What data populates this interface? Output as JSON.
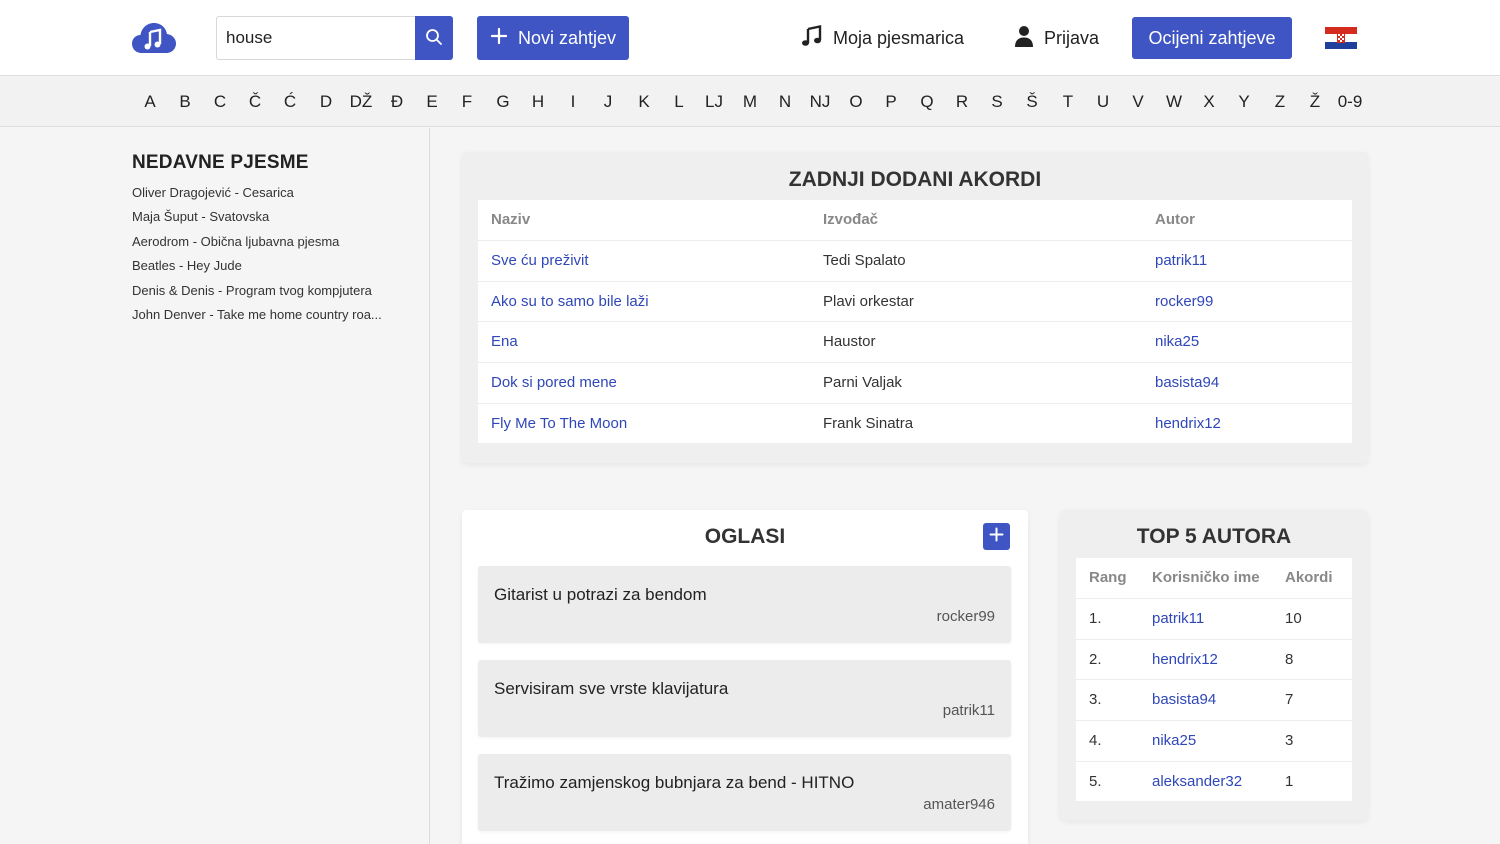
{
  "header": {
    "logo": "music-cloud-logo",
    "search_value": "house",
    "search_placeholder": "",
    "new_request_label": "Novi zahtjev",
    "songbook_label": "Moja pjesmarica",
    "login_label": "Prijava",
    "rate_requests_label": "Ocijeni zahtjeve",
    "language_flag": "croatian-flag"
  },
  "alphabet": [
    "A",
    "B",
    "C",
    "Č",
    "Ć",
    "D",
    "DŽ",
    "Đ",
    "E",
    "F",
    "G",
    "H",
    "I",
    "J",
    "K",
    "L",
    "LJ",
    "M",
    "N",
    "NJ",
    "O",
    "P",
    "Q",
    "R",
    "S",
    "Š",
    "T",
    "U",
    "V",
    "W",
    "X",
    "Y",
    "Z",
    "Ž",
    "0-9"
  ],
  "recent": {
    "title": "NEDAVNE PJESME",
    "items": [
      "Oliver Dragojević - Cesarica",
      "Maja Šuput - Svatovska",
      "Aerodrom - Obična ljubavna pjesma",
      "Beatles - Hey Jude",
      "Denis & Denis - Program tvog kompjutera",
      "John Denver - Take me home country roa..."
    ]
  },
  "latest_chords": {
    "title": "ZADNJI DODANI AKORDI",
    "columns": [
      "Naziv",
      "Izvođač",
      "Autor"
    ],
    "rows": [
      [
        "Sve ću preživit",
        "Tedi Spalato",
        "patrik11"
      ],
      [
        "Ako su to samo bile laži",
        "Plavi orkestar",
        "rocker99"
      ],
      [
        "Ena",
        "Haustor",
        "nika25"
      ],
      [
        "Dok si pored mene",
        "Parni Valjak",
        "basista94"
      ],
      [
        "Fly Me To The Moon",
        "Frank Sinatra",
        "hendrix12"
      ]
    ]
  },
  "ads": {
    "title": "OGLASI",
    "items": [
      {
        "title": "Gitarist u potrazi za bendom",
        "author": "rocker99"
      },
      {
        "title": "Servisiram sve vrste klavijatura",
        "author": "patrik11"
      },
      {
        "title": "Tražimo zamjenskog bubnjara za bend - HITNO",
        "author": "amater946"
      }
    ]
  },
  "top_authors": {
    "title": "TOP 5 AUTORA",
    "columns": [
      "Rang",
      "Korisničko ime",
      "Akordi"
    ],
    "rows": [
      [
        "1.",
        "patrik11",
        "10"
      ],
      [
        "2.",
        "hendrix12",
        "8"
      ],
      [
        "3.",
        "basista94",
        "7"
      ],
      [
        "4.",
        "nika25",
        "3"
      ],
      [
        "5.",
        "aleksander32",
        "1"
      ]
    ]
  },
  "colors": {
    "accent": "#3f55c4",
    "link": "#2f47b8"
  }
}
